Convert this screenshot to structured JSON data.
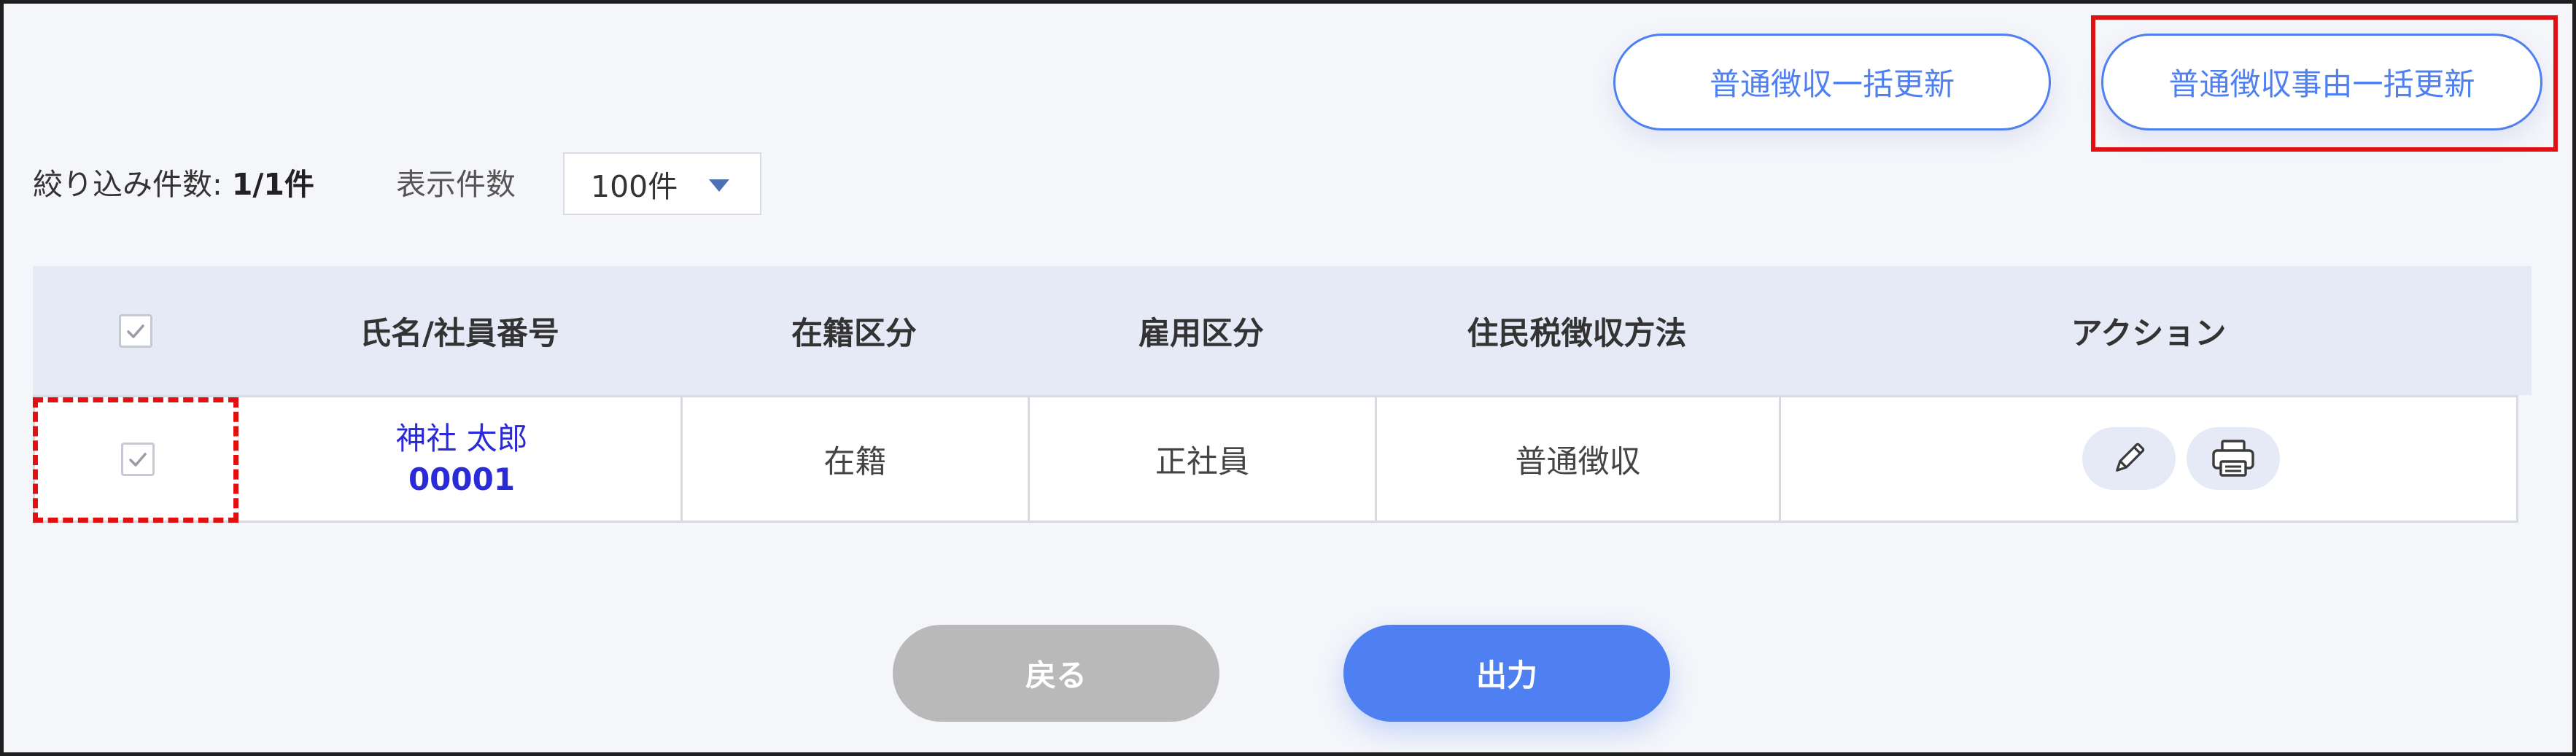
{
  "toolbar": {
    "bulk_update_label": "普通徴収一括更新",
    "bulk_reason_update_label": "普通徴収事由一括更新"
  },
  "filter": {
    "count_label": "絞り込み件数:",
    "count_value": "1/1件",
    "per_page_label": "表示件数",
    "per_page_value": "100件"
  },
  "table": {
    "headers": [
      "",
      "氏名/社員番号",
      "在籍区分",
      "雇用区分",
      "住民税徴収方法",
      "アクション"
    ],
    "rows": [
      {
        "checked": true,
        "name": "神社 太郎",
        "employee_no": "00001",
        "enrollment": "在籍",
        "employment_type": "正社員",
        "collection_method": "普通徴収",
        "actions": [
          "pencil-icon",
          "printer-icon"
        ]
      }
    ]
  },
  "footer": {
    "back_label": "戻る",
    "output_label": "出力"
  },
  "colors": {
    "accent": "#4e80f1",
    "highlight": "#e21010",
    "header_bg": "#e6e9f6",
    "link": "#2a2ad8",
    "disabled": "#b9b9b9"
  }
}
